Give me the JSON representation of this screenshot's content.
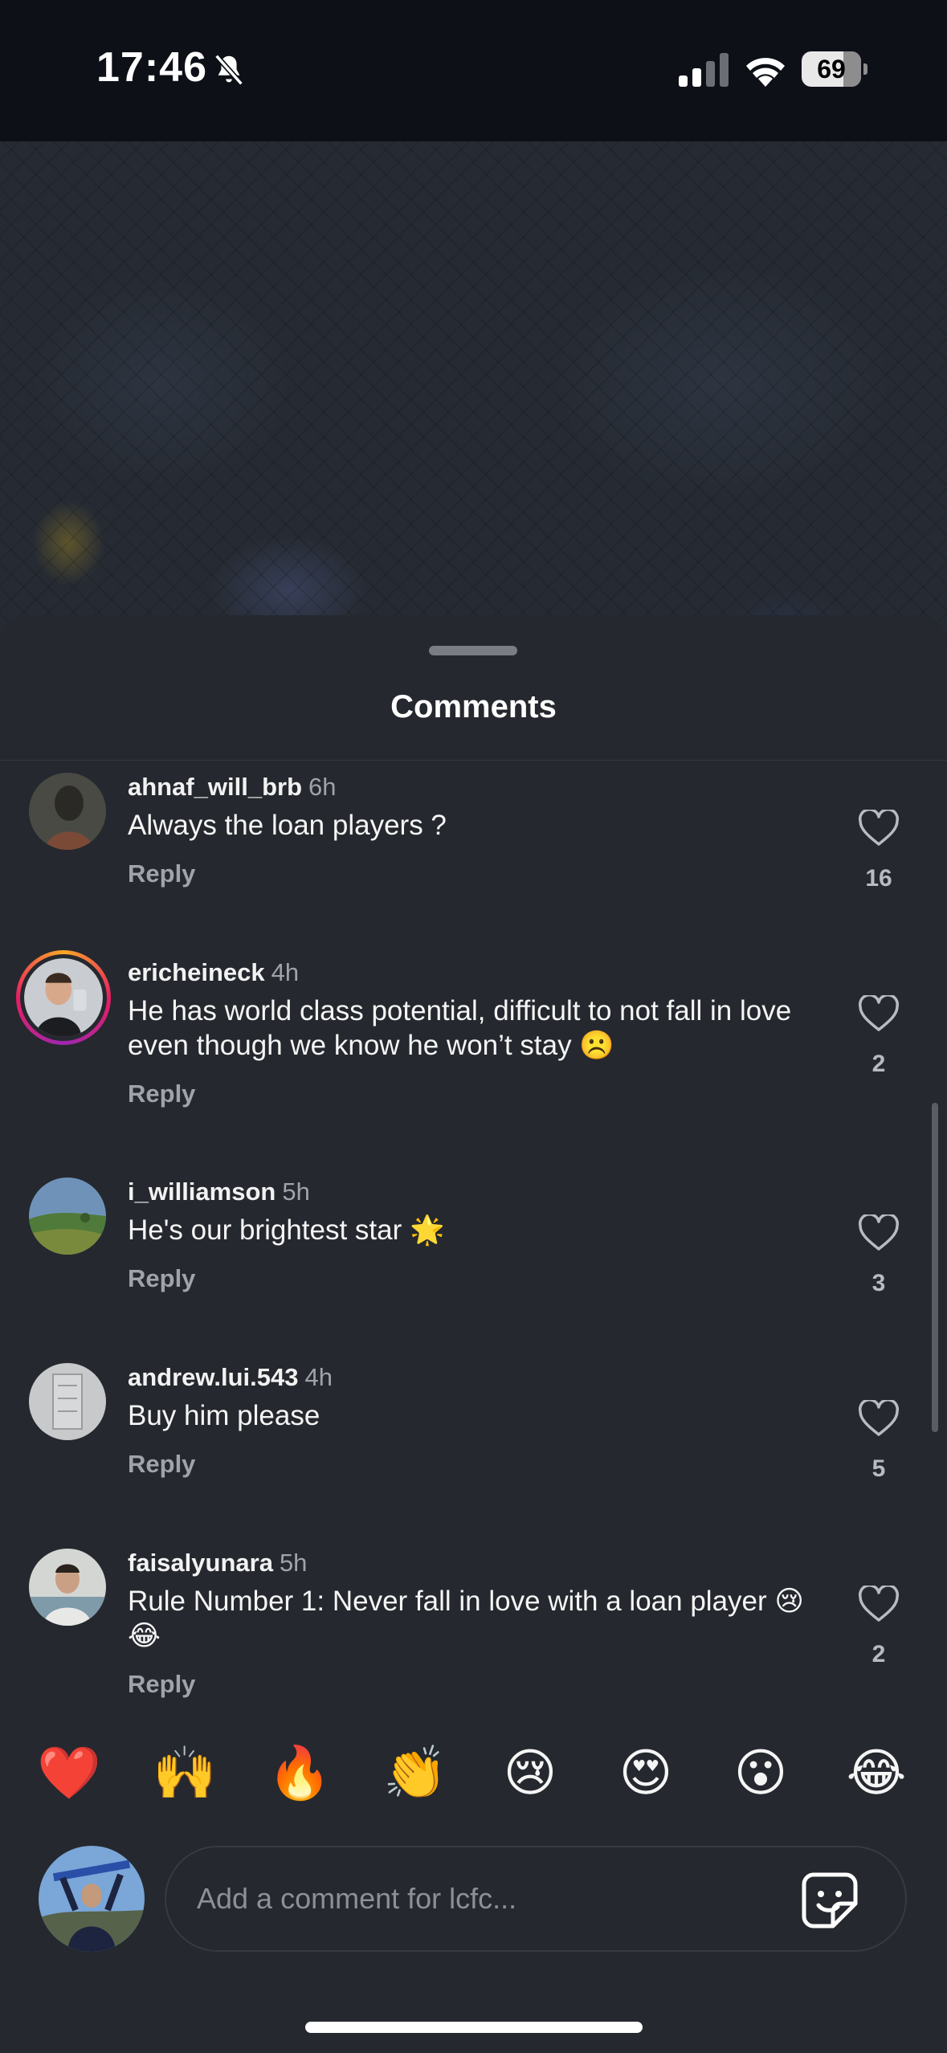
{
  "status_bar": {
    "time": "17:46",
    "battery": "69"
  },
  "sheet": {
    "title": "Comments"
  },
  "comments": [
    {
      "username": "ahnaf_will_brb",
      "time": "6h",
      "text": "Always the loan players ?",
      "reply": "Reply",
      "likes": "16"
    },
    {
      "username": "ericheineck",
      "time": "4h",
      "text": "He has world class potential, difficult to not fall in love even though we know he won’t stay ☹️",
      "reply": "Reply",
      "likes": "2"
    },
    {
      "username": "i_williamson",
      "time": "5h",
      "text": "He's our brightest star 🌟",
      "reply": "Reply",
      "likes": "3"
    },
    {
      "username": "andrew.lui.543",
      "time": "4h",
      "text": "Buy him please",
      "reply": "Reply",
      "likes": "5"
    },
    {
      "username": "faisalyunara",
      "time": "5h",
      "text": "Rule Number 1: Never fall in love with a loan player 😢😂",
      "reply": "Reply",
      "likes": "2"
    }
  ],
  "reactions": [
    "❤️",
    "🙌",
    "🔥",
    "👏",
    "😢",
    "😍",
    "😮",
    "😂"
  ],
  "composer": {
    "placeholder": "Add a comment for lcfc..."
  },
  "colors": {
    "sheet_bg": "#25282e",
    "muted_text": "#9fa3aa",
    "story_ring_start": "#f9a825",
    "story_ring_end": "#9c27b0"
  },
  "icons": {
    "bell": "bell-slash-icon",
    "signal": "cellular-signal-icon",
    "wifi": "wifi-icon",
    "like": "heart-outline-icon",
    "sticker": "sticker-icon"
  }
}
